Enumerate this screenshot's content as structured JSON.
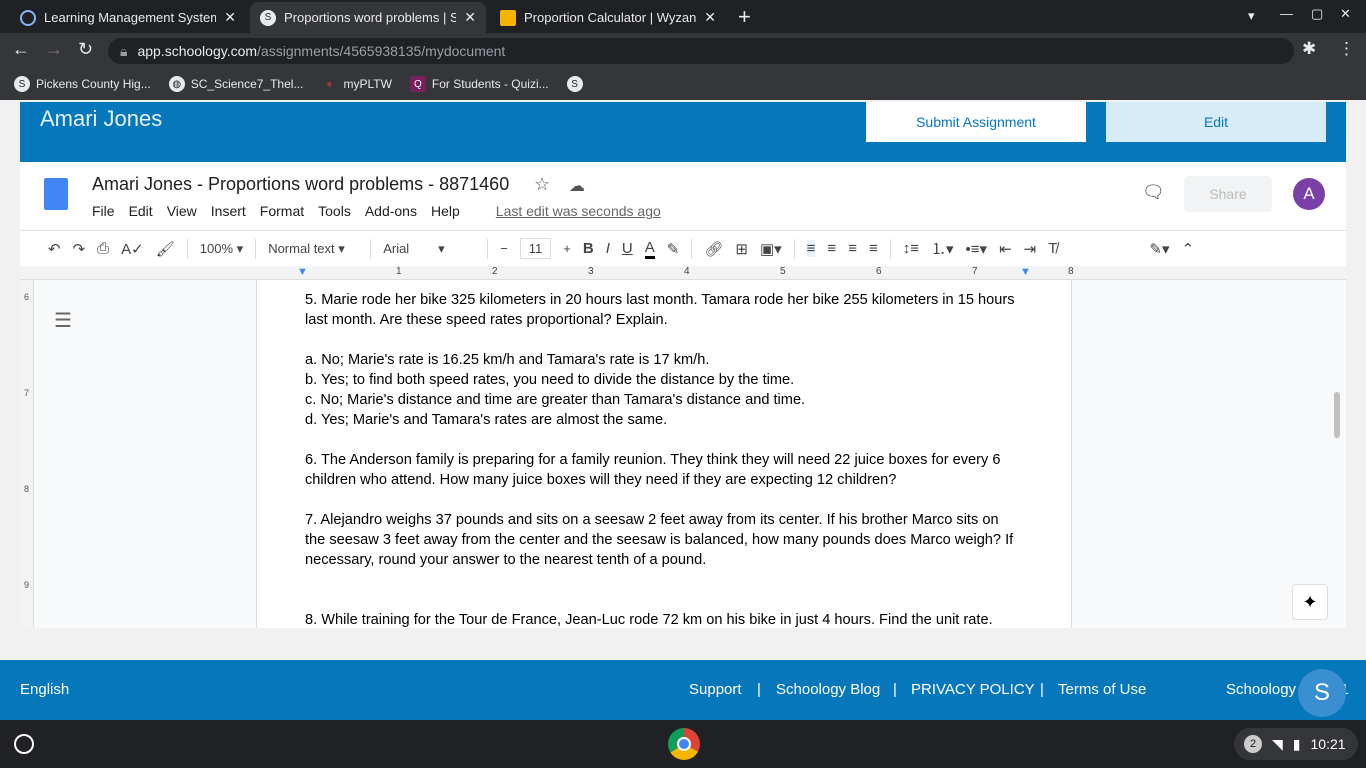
{
  "browser": {
    "tabs": [
      {
        "title": "Learning Management System |",
        "active": false
      },
      {
        "title": "Proportions word problems | Sch",
        "active": true
      },
      {
        "title": "Proportion Calculator | Wyzant R",
        "active": false
      }
    ],
    "url_host": "app.schoology.com",
    "url_path": "/assignments/4565938135/mydocument",
    "bookmarks": [
      "Pickens County Hig...",
      "SC_Science7_Thel...",
      "myPLTW",
      "For Students - Quizi..."
    ]
  },
  "schoology": {
    "user": "Amari Jones",
    "submit": "Submit Assignment",
    "edit": "Edit",
    "accent": "#0677ba"
  },
  "docs": {
    "title": "Amari Jones - Proportions word problems - 8871460",
    "menu": [
      "File",
      "Edit",
      "View",
      "Insert",
      "Format",
      "Tools",
      "Add-ons",
      "Help"
    ],
    "last_edit": "Last edit was seconds ago",
    "share": "Share",
    "avatar": "A",
    "zoom": "100%",
    "style": "Normal text",
    "font": "Arial",
    "size": "11",
    "ruler": [
      "1",
      "2",
      "3",
      "4",
      "5",
      "6",
      "7",
      "8"
    ],
    "vruler": [
      "6",
      "7",
      "8",
      "9"
    ],
    "lines": [
      "5. Marie rode her bike 325 kilometers in 20 hours last month. Tamara rode her bike 255 kilometers in 15 hours",
      "last month. Are these speed rates proportional? Explain.",
      "a. No; Marie's rate is 16.25 km/h and Tamara's rate is 17 km/h.",
      "b. Yes; to find both speed rates, you need to divide the distance by the time.",
      "c. No; Marie's distance and time are greater than Tamara's distance and time.",
      "d. Yes; Marie's and Tamara's rates are almost the same.",
      "6. The Anderson family is preparing for a family reunion. They think they will need 22 juice boxes for every 6",
      "children who attend. How many juice boxes will they need if they are expecting 12 children?",
      "7. Alejandro weighs 37 pounds and sits on a seesaw 2 feet away from its center. If his brother Marco sits on",
      "the  seesaw 3 feet away from the center and the seesaw is balanced, how many pounds does Marco weigh? If",
      "necessary, round your answer to the nearest tenth of a pound.",
      "8. While training for the Tour de France, Jean-Luc rode 72 km on his bike in just 4 hours. Find the unit rate."
    ]
  },
  "footer": {
    "language": "English",
    "links": [
      "Support",
      "Schoology Blog",
      "PRIVACY POLICY",
      "Terms of Use"
    ],
    "brand": "Schoology © 2021"
  },
  "shelf": {
    "notifications": "2",
    "time": "10:21"
  }
}
